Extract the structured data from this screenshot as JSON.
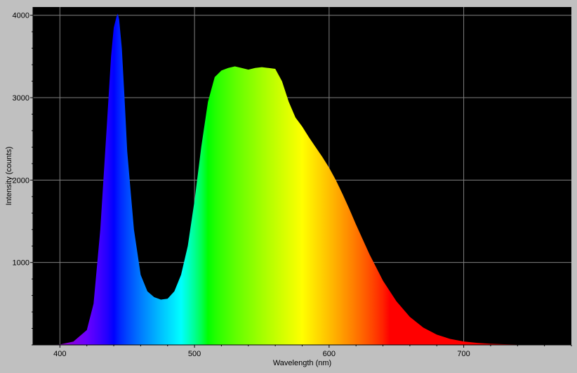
{
  "chart_data": {
    "type": "area",
    "title": "",
    "xlabel": "Wavelength (nm)",
    "ylabel": "Intensity (counts)",
    "xlim": [
      380,
      780
    ],
    "ylim": [
      0,
      4100
    ],
    "x_ticks": [
      400,
      500,
      600,
      700
    ],
    "y_ticks": [
      1000,
      2000,
      3000,
      4000
    ],
    "grid": true,
    "fill": "visible-spectrum",
    "colors": {
      "plot_background": "#000000",
      "frame": "#c0c0c0",
      "grid": "#808080"
    },
    "series": [
      {
        "x": [
          380,
          400,
          410,
          420,
          425,
          430,
          435,
          438,
          440,
          442,
          443,
          444,
          446,
          448,
          450,
          455,
          460,
          465,
          470,
          475,
          480,
          485,
          490,
          495,
          500,
          505,
          510,
          515,
          520,
          525,
          530,
          535,
          540,
          545,
          550,
          555,
          560,
          565,
          570,
          575,
          580,
          585,
          590,
          595,
          600,
          605,
          610,
          615,
          620,
          625,
          630,
          640,
          650,
          660,
          670,
          680,
          690,
          700,
          710,
          720,
          730,
          740,
          750,
          760,
          770,
          780
        ],
        "y": [
          0,
          5,
          40,
          180,
          500,
          1400,
          2700,
          3500,
          3850,
          3980,
          4020,
          3950,
          3600,
          3000,
          2350,
          1400,
          850,
          650,
          580,
          550,
          560,
          650,
          850,
          1200,
          1750,
          2400,
          2950,
          3250,
          3330,
          3360,
          3380,
          3360,
          3340,
          3360,
          3370,
          3360,
          3350,
          3200,
          2950,
          2760,
          2650,
          2520,
          2400,
          2280,
          2150,
          2000,
          1830,
          1650,
          1460,
          1280,
          1100,
          780,
          530,
          340,
          210,
          125,
          72,
          42,
          24,
          14,
          8,
          4,
          2,
          1,
          0,
          0
        ]
      }
    ]
  }
}
